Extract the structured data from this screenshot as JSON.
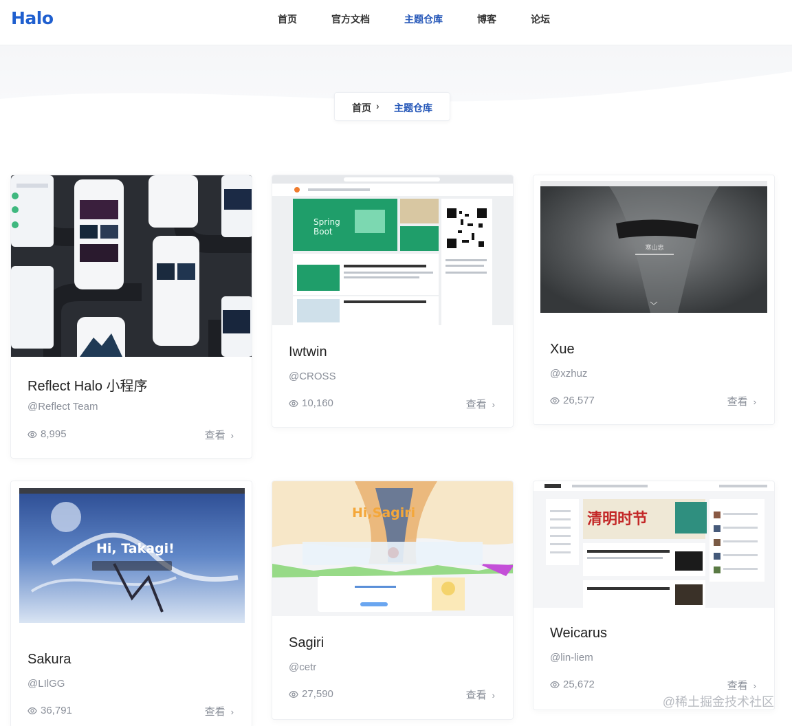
{
  "header": {
    "logo": "Halo",
    "nav": [
      "首页",
      "官方文档",
      "主题仓库",
      "博客",
      "论坛"
    ],
    "active_index": 2
  },
  "breadcrumb": {
    "home": "首页",
    "separator": "›",
    "current": "主题仓库"
  },
  "cards": [
    {
      "name": "Reflect Halo 小程序",
      "author": "@Reflect Team",
      "views": "8,995",
      "more": "查看"
    },
    {
      "name": "Iwtwin",
      "author": "@CROSS",
      "views": "10,160",
      "more": "查看"
    },
    {
      "name": "Xue",
      "author": "@xzhuz",
      "views": "26,577",
      "more": "查看"
    },
    {
      "name": "Sakura",
      "author": "@LIlGG",
      "views": "36,791",
      "more": "查看"
    },
    {
      "name": "Sagiri",
      "author": "@cetr",
      "views": "27,590",
      "more": "查看"
    },
    {
      "name": "Weicarus",
      "author": "@lin-liem",
      "views": "25,672",
      "more": "查看"
    }
  ],
  "thumb_text": {
    "spring": "Spring Boot",
    "xue_title": "寒山忠",
    "sakura_title": "Hi, Takagi!",
    "sagiri_title": "Hi,Sagiri",
    "weicarus_banner": "清明时节"
  },
  "watermark": "@稀土掘金技术社区",
  "colors": {
    "accent": "#2456b8",
    "text": "#222222",
    "muted": "#8a8f99"
  }
}
